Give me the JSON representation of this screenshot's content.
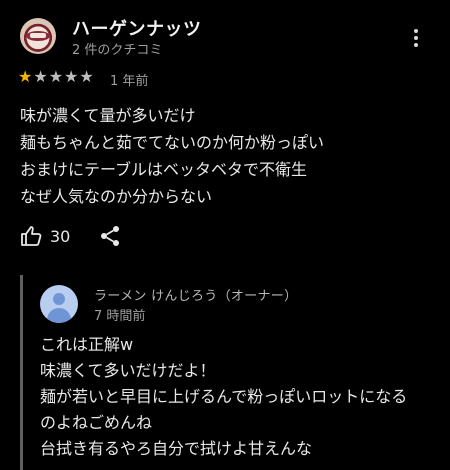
{
  "review": {
    "reviewer_name": "ハーゲンナッツ",
    "reviewer_meta": "2 件のクチコミ",
    "rating": 1,
    "rating_max": 5,
    "time": "1 年前",
    "body_lines": [
      "味が濃くて量が多いだけ",
      "麺もちゃんと茹でてないのか何か粉っぽい",
      "おまけにテーブルはベッタベタで不衛生",
      "なぜ人気なのか分からない"
    ],
    "like_count": "30",
    "icons": {
      "avatar": "reviewer-avatar",
      "more": "more-vert-icon",
      "like": "thumb-up-icon",
      "share": "share-icon",
      "star_filled": "star-filled-icon",
      "star_empty": "star-empty-icon"
    },
    "colors": {
      "star": "#f6b400",
      "background": "#000000"
    }
  },
  "owner_reply": {
    "name": "ラーメン けんじろう（オーナー）",
    "time": "7 時間前",
    "body_lines": [
      "これは正解w",
      "味濃くて多いだけだよ！",
      "麺が若いと早目に上げるんで粉っぽいロットになる",
      "のよねごめんね",
      "台拭き有るやろ自分で拭けよ甘えんな"
    ]
  }
}
